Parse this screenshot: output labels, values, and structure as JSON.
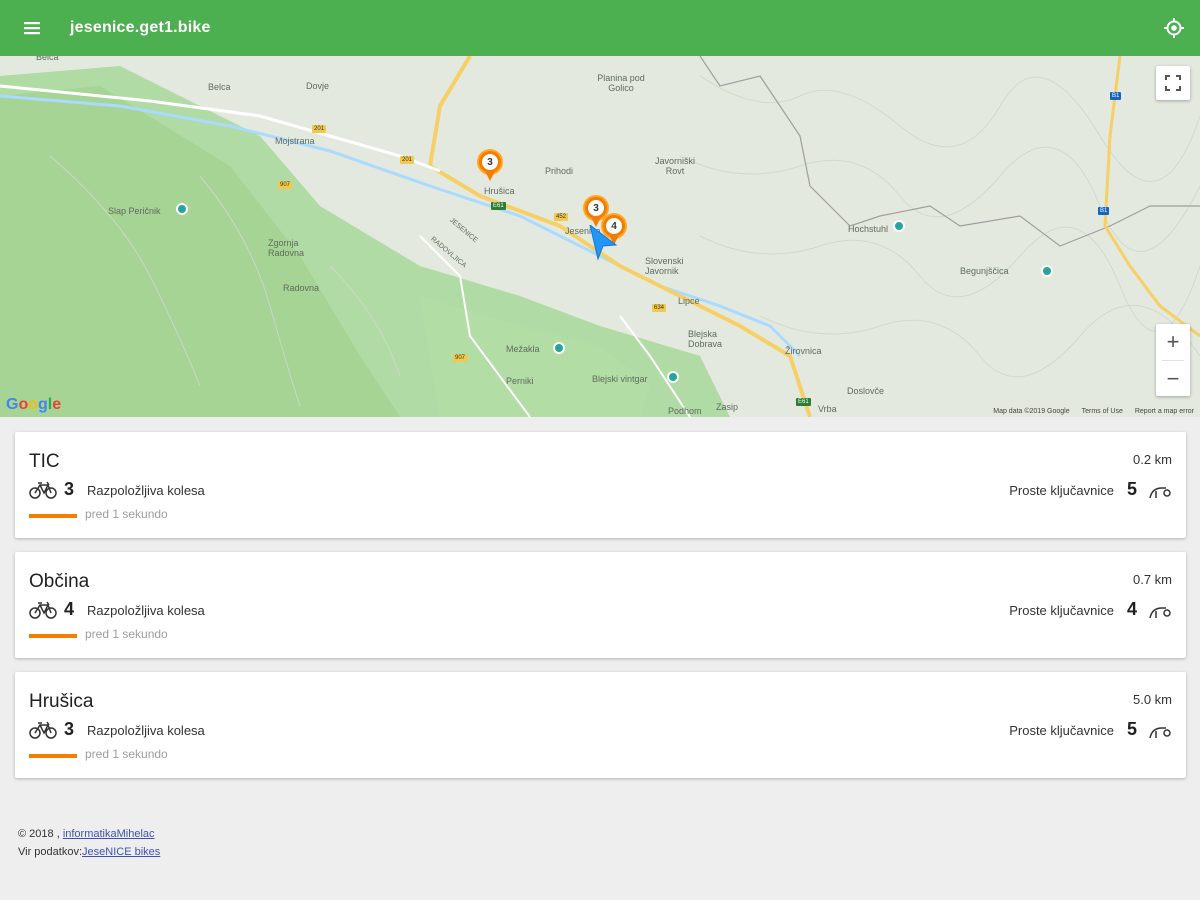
{
  "header": {
    "title": "jesenice.get1.bike",
    "menu_icon": "menu-icon",
    "locate_icon": "my-location-icon",
    "color": "#4caf50"
  },
  "map": {
    "place_labels": [
      "Belca",
      "Dovje",
      "Mojstrana",
      "Planina pod Golico",
      "Prihodi",
      "Hrušica",
      "Javorniški Rovt",
      "Slap Peričnik",
      "Zgornja Radovna",
      "Radovna",
      "JESENICE",
      "RADOVLJICA",
      "Jesenice",
      "Slovenski Javornik",
      "Lipce",
      "Blejska Dobrava",
      "Mežakla",
      "Blejski vintgar",
      "Zasip",
      "Podhom",
      "Žirovnica",
      "Doslovče",
      "Vrba",
      "Begunjščica",
      "Hochstuhl",
      "Perniki"
    ],
    "clusters": [
      {
        "count": "3"
      },
      {
        "count": "3"
      },
      {
        "count": "4"
      }
    ],
    "google_logo": "Google",
    "attribution": {
      "map_data": "Map data ©2019 Google",
      "terms": "Terms of Use",
      "report": "Report a map error"
    },
    "zoom_in": "+",
    "zoom_out": "−"
  },
  "stations": [
    {
      "name": "TIC",
      "distance": "0.2 km",
      "bikes": "3",
      "bikes_label": "Razpoložljiva kolesa",
      "updated": "pred 1 sekundo",
      "docks_label": "Proste ključavnice",
      "docks": "5"
    },
    {
      "name": "Občina",
      "distance": "0.7 km",
      "bikes": "4",
      "bikes_label": "Razpoložljiva kolesa",
      "updated": "pred 1 sekundo",
      "docks_label": "Proste ključavnice",
      "docks": "4"
    },
    {
      "name": "Hrušica",
      "distance": "5.0 km",
      "bikes": "3",
      "bikes_label": "Razpoložljiva kolesa",
      "updated": "pred 1 sekundo",
      "docks_label": "Proste ključavnice",
      "docks": "5"
    }
  ],
  "footer": {
    "copyright": "© 2018 ,",
    "author_link": "informatikaMihelac",
    "source_label": "Vir podatkov:",
    "source_link": "JeseNICE bikes"
  },
  "colors": {
    "accent": "#f57c00",
    "bar": "#4caf50"
  }
}
